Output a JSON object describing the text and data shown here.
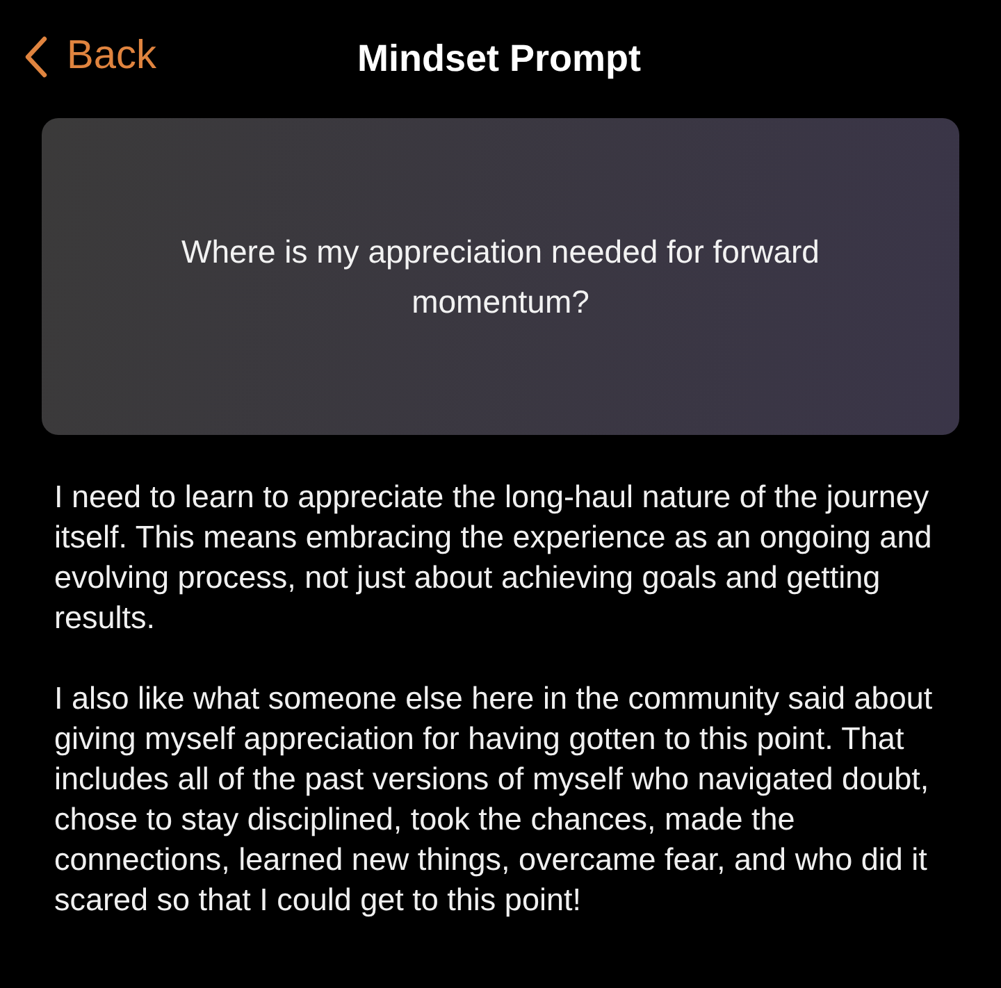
{
  "nav": {
    "back": "Back",
    "title": "Mindset Prompt"
  },
  "prompt": "Where is my appreciation needed for forward momentum?",
  "answer": [
    "I need to learn to appreciate the long-haul nature of the journey itself. This means embracing the experience as an ongoing and evolving process, not just about achieving goals and getting results.",
    "I also like what someone else here in the community said about giving myself appreciation for having gotten to this point. That includes all of the past versions of myself who navigated doubt, chose to stay disciplined, took the chances, made the connections, learned new things, overcame fear, and who did it scared so that I could get to this point!"
  ]
}
